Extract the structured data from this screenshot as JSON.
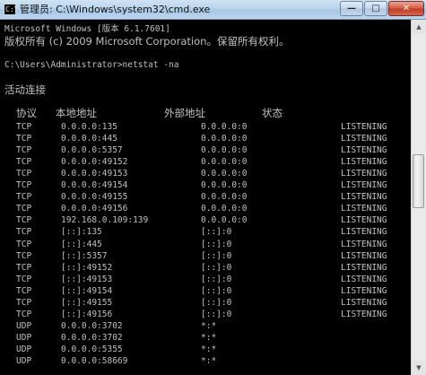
{
  "window": {
    "title": "管理员: C:\\Windows\\system32\\cmd.exe",
    "icon_text": "C:\\",
    "minimize": "—",
    "maximize": "□",
    "close": "✕"
  },
  "console": {
    "lines": [
      "Microsoft Windows [版本 6.1.7601]",
      "版权所有 (c) 2009 Microsoft Corporation。保留所有权利。",
      "",
      "C:\\Users\\Administrator>netstat -na",
      "",
      "活动连接"
    ],
    "headers": {
      "proto": "协议",
      "local": "本地地址",
      "foreign": "外部地址",
      "state": "状态"
    },
    "rows": [
      {
        "proto": "TCP",
        "local": "0.0.0.0:135",
        "foreign": "0.0.0.0:0",
        "state": "LISTENING"
      },
      {
        "proto": "TCP",
        "local": "0.0.0.0:445",
        "foreign": "0.0.0.0:0",
        "state": "LISTENING"
      },
      {
        "proto": "TCP",
        "local": "0.0.0.0:5357",
        "foreign": "0.0.0.0:0",
        "state": "LISTENING"
      },
      {
        "proto": "TCP",
        "local": "0.0.0.0:49152",
        "foreign": "0.0.0.0:0",
        "state": "LISTENING"
      },
      {
        "proto": "TCP",
        "local": "0.0.0.0:49153",
        "foreign": "0.0.0.0:0",
        "state": "LISTENING"
      },
      {
        "proto": "TCP",
        "local": "0.0.0.0:49154",
        "foreign": "0.0.0.0:0",
        "state": "LISTENING"
      },
      {
        "proto": "TCP",
        "local": "0.0.0.0:49155",
        "foreign": "0.0.0.0:0",
        "state": "LISTENING"
      },
      {
        "proto": "TCP",
        "local": "0.0.0.0:49156",
        "foreign": "0.0.0.0:0",
        "state": "LISTENING"
      },
      {
        "proto": "TCP",
        "local": "192.168.0.109:139",
        "foreign": "0.0.0.0:0",
        "state": "LISTENING"
      },
      {
        "proto": "TCP",
        "local": "[::]:135",
        "foreign": "[::]:0",
        "state": "LISTENING"
      },
      {
        "proto": "TCP",
        "local": "[::]:445",
        "foreign": "[::]:0",
        "state": "LISTENING"
      },
      {
        "proto": "TCP",
        "local": "[::]:5357",
        "foreign": "[::]:0",
        "state": "LISTENING"
      },
      {
        "proto": "TCP",
        "local": "[::]:49152",
        "foreign": "[::]:0",
        "state": "LISTENING"
      },
      {
        "proto": "TCP",
        "local": "[::]:49153",
        "foreign": "[::]:0",
        "state": "LISTENING"
      },
      {
        "proto": "TCP",
        "local": "[::]:49154",
        "foreign": "[::]:0",
        "state": "LISTENING"
      },
      {
        "proto": "TCP",
        "local": "[::]:49155",
        "foreign": "[::]:0",
        "state": "LISTENING"
      },
      {
        "proto": "TCP",
        "local": "[::]:49156",
        "foreign": "[::]:0",
        "state": "LISTENING"
      },
      {
        "proto": "UDP",
        "local": "0.0.0.0:3702",
        "foreign": "*:*",
        "state": ""
      },
      {
        "proto": "UDP",
        "local": "0.0.0.0:3702",
        "foreign": "*:*",
        "state": ""
      },
      {
        "proto": "UDP",
        "local": "0.0.0.0:5355",
        "foreign": "*:*",
        "state": ""
      },
      {
        "proto": "UDP",
        "local": "0.0.0.0:58669",
        "foreign": "*:*",
        "state": ""
      }
    ]
  },
  "colors": {
    "console_bg": "#000000",
    "console_text": "#c0c0c0"
  }
}
